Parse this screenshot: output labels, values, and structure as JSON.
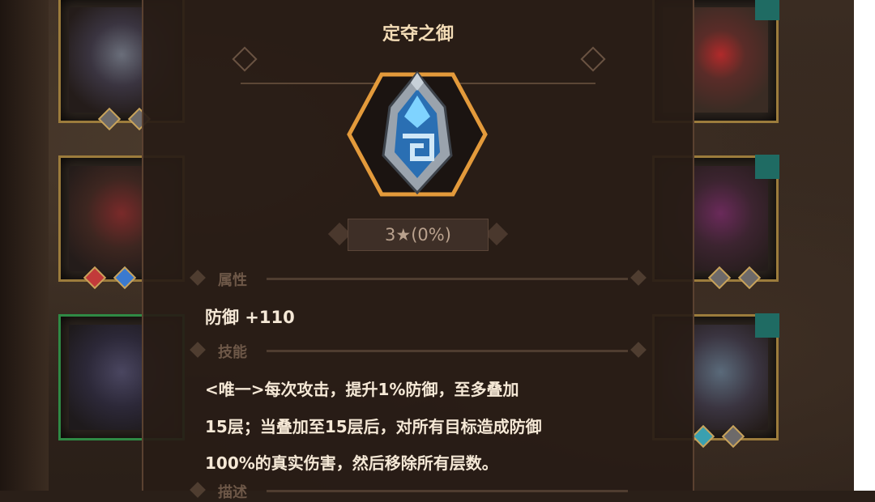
{
  "item": {
    "title": "定夺之御",
    "stars": "3★(0%)",
    "icon": "shield-gem-icon"
  },
  "sections": {
    "attributes_label": "属性",
    "skill_label": "技能",
    "description_label": "描述"
  },
  "attributes": {
    "defense": "防御 +110"
  },
  "skill": {
    "line1": "<唯一>每次攻击，提升1%防御，至多叠加",
    "line2": "15层；当叠加至15层后，对所有目标造成防御",
    "line3": "100%的真实伤害，然后移除所有层数。"
  },
  "colors": {
    "hex_border": "#e39a3b",
    "gem_blue": "#3aa8e0",
    "panel_bg": "#281c16",
    "text_main": "#f5e8d6"
  }
}
